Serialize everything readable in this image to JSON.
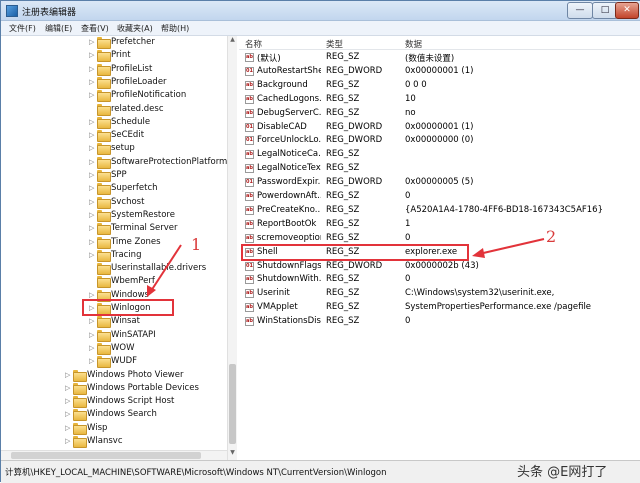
{
  "window": {
    "title": "注册表编辑器",
    "buttons": {
      "minimize": "—",
      "maximize": "□",
      "close": "✕"
    }
  },
  "menu": {
    "items": [
      "文件(F)",
      "编辑(E)",
      "查看(V)",
      "收藏夹(A)",
      "帮助(H)"
    ]
  },
  "tree": {
    "items": [
      {
        "label": "Prefetcher",
        "indent": 1,
        "expandable": true
      },
      {
        "label": "Print",
        "indent": 1,
        "expandable": true
      },
      {
        "label": "ProfileList",
        "indent": 1,
        "expandable": true
      },
      {
        "label": "ProfileLoader",
        "indent": 1,
        "expandable": true
      },
      {
        "label": "ProfileNotification",
        "indent": 1,
        "expandable": true
      },
      {
        "label": "related.desc",
        "indent": 1,
        "expandable": false
      },
      {
        "label": "Schedule",
        "indent": 1,
        "expandable": true
      },
      {
        "label": "SeCEdit",
        "indent": 1,
        "expandable": true
      },
      {
        "label": "setup",
        "indent": 1,
        "expandable": true
      },
      {
        "label": "SoftwareProtectionPlatform",
        "indent": 1,
        "expandable": true
      },
      {
        "label": "SPP",
        "indent": 1,
        "expandable": true
      },
      {
        "label": "Superfetch",
        "indent": 1,
        "expandable": true
      },
      {
        "label": "Svchost",
        "indent": 1,
        "expandable": true
      },
      {
        "label": "SystemRestore",
        "indent": 1,
        "expandable": true
      },
      {
        "label": "Terminal Server",
        "indent": 1,
        "expandable": true
      },
      {
        "label": "Time Zones",
        "indent": 1,
        "expandable": true
      },
      {
        "label": "Tracing",
        "indent": 1,
        "expandable": true
      },
      {
        "label": "Userinstallable.drivers",
        "indent": 1,
        "expandable": false
      },
      {
        "label": "WbemPerf",
        "indent": 1,
        "expandable": false
      },
      {
        "label": "Windows",
        "indent": 1,
        "expandable": true
      },
      {
        "label": "Winlogon",
        "indent": 1,
        "expandable": true,
        "selected": true
      },
      {
        "label": "Winsat",
        "indent": 1,
        "expandable": true
      },
      {
        "label": "WinSATAPI",
        "indent": 1,
        "expandable": true
      },
      {
        "label": "WOW",
        "indent": 1,
        "expandable": true
      },
      {
        "label": "WUDF",
        "indent": 1,
        "expandable": true
      },
      {
        "label": "Windows Photo Viewer",
        "indent": 0,
        "expandable": true
      },
      {
        "label": "Windows Portable Devices",
        "indent": 0,
        "expandable": true
      },
      {
        "label": "Windows Script Host",
        "indent": 0,
        "expandable": true
      },
      {
        "label": "Windows Search",
        "indent": 0,
        "expandable": true
      },
      {
        "label": "Wisp",
        "indent": 0,
        "expandable": true
      },
      {
        "label": "Wlansvc",
        "indent": 0,
        "expandable": true
      }
    ]
  },
  "values_pane": {
    "headers": {
      "name": "名称",
      "type": "类型",
      "data": "数据"
    },
    "rows": [
      {
        "name": "(默认)",
        "type": "REG_SZ",
        "data": "(数值未设置)"
      },
      {
        "name": "AutoRestartShell",
        "type": "REG_DWORD",
        "data": "0x00000001 (1)"
      },
      {
        "name": "Background",
        "type": "REG_SZ",
        "data": "0 0 0"
      },
      {
        "name": "CachedLogons...",
        "type": "REG_SZ",
        "data": "10"
      },
      {
        "name": "DebugServerC...",
        "type": "REG_SZ",
        "data": "no"
      },
      {
        "name": "DisableCAD",
        "type": "REG_DWORD",
        "data": "0x00000001 (1)"
      },
      {
        "name": "ForceUnlockLo...",
        "type": "REG_DWORD",
        "data": "0x00000000 (0)"
      },
      {
        "name": "LegalNoticeCa...",
        "type": "REG_SZ",
        "data": ""
      },
      {
        "name": "LegalNoticeText",
        "type": "REG_SZ",
        "data": ""
      },
      {
        "name": "PasswordExpir...",
        "type": "REG_DWORD",
        "data": "0x00000005 (5)"
      },
      {
        "name": "PowerdownAft...",
        "type": "REG_SZ",
        "data": "0"
      },
      {
        "name": "PreCreateKno...",
        "type": "REG_SZ",
        "data": "{A520A1A4-1780-4FF6-BD18-167343C5AF16}"
      },
      {
        "name": "ReportBootOk",
        "type": "REG_SZ",
        "data": "1"
      },
      {
        "name": "scremoveoption",
        "type": "REG_SZ",
        "data": "0"
      },
      {
        "name": "Shell",
        "type": "REG_SZ",
        "data": "explorer.exe",
        "highlighted": true
      },
      {
        "name": "ShutdownFlags",
        "type": "REG_DWORD",
        "data": "0x0000002b (43)"
      },
      {
        "name": "ShutdownWith...",
        "type": "REG_SZ",
        "data": "0"
      },
      {
        "name": "Userinit",
        "type": "REG_SZ",
        "data": "C:\\Windows\\system32\\userinit.exe,"
      },
      {
        "name": "VMApplet",
        "type": "REG_SZ",
        "data": "SystemPropertiesPerformance.exe /pagefile"
      },
      {
        "name": "WinStationsDis...",
        "type": "REG_SZ",
        "data": "0"
      }
    ]
  },
  "status": {
    "path": "计算机\\HKEY_LOCAL_MACHINE\\SOFTWARE\\Microsoft\\Windows NT\\CurrentVersion\\Winlogon"
  },
  "annotations": {
    "marker_1": "1",
    "marker_2": "2",
    "color": "#e2333a"
  },
  "watermark": "头条 @E网打了"
}
